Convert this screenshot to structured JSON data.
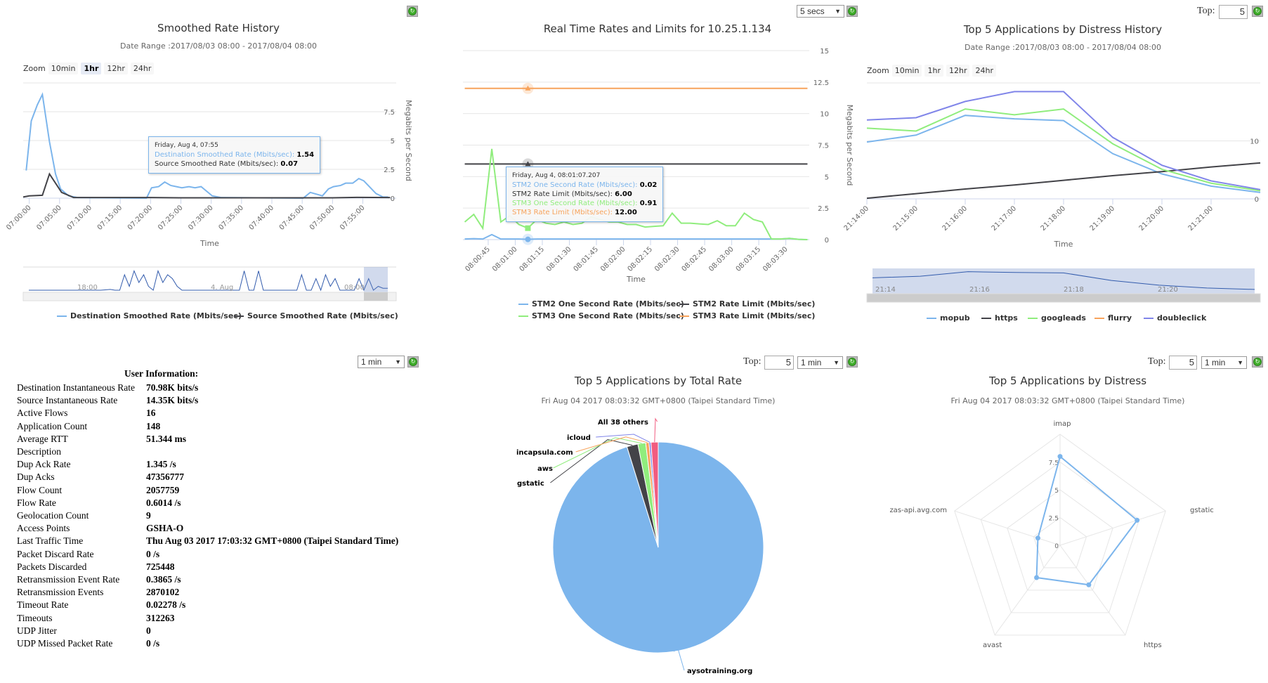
{
  "smoothed": {
    "title": "Smoothed Rate History",
    "date_range": "Date Range :2017/08/03 08:00 - 2017/08/04 08:00",
    "zoom_label": "Zoom",
    "zoom_buttons": [
      "10min",
      "1hr",
      "12hr",
      "24hr"
    ],
    "zoom_selected": "1hr",
    "navigator_labels": [
      "18:00",
      "4. Aug",
      "08:00"
    ],
    "tooltip": {
      "header": "Friday, Aug 4, 07:55",
      "rows": [
        {
          "label": "Destination Smoothed Rate (Mbits/sec): ",
          "value": "1.54",
          "color": "#7cb5ec"
        },
        {
          "label": "Source Smoothed Rate (Mbits/sec): ",
          "value": "0.07",
          "color": "#333333"
        }
      ]
    }
  },
  "realtime": {
    "title": "Real Time Rates and Limits for 10.25.1.134",
    "interval": "5 secs",
    "tooltip": {
      "header": "Friday, Aug 4, 08:01:07.207",
      "rows": [
        {
          "label": "STM2 One Second Rate (Mbits/sec): ",
          "value": "0.02",
          "color": "#7cb5ec"
        },
        {
          "label": "STM2 Rate Limit (Mbits/sec): ",
          "value": "6.00",
          "color": "#333333"
        },
        {
          "label": "STM3 One Second Rate (Mbits/sec): ",
          "value": "0.91",
          "color": "#90ed7d"
        },
        {
          "label": "STM3 Rate Limit (Mbits/sec): ",
          "value": "12.00",
          "color": "#f7a35c"
        }
      ]
    }
  },
  "distress_history": {
    "title": "Top 5 Applications by Distress History",
    "date_range": "Date Range :2017/08/03 08:00 - 2017/08/04 08:00",
    "top_label": "Top:",
    "top_value": "5",
    "zoom_label": "Zoom",
    "zoom_buttons": [
      "10min",
      "1hr",
      "12hr",
      "24hr"
    ],
    "navigator_labels": [
      "21:14",
      "21:16",
      "21:18",
      "21:20"
    ]
  },
  "user_info": {
    "interval": "1 min",
    "header": "User Information:",
    "rows": [
      {
        "label": "Destination Instantaneous Rate",
        "value": "70.98K bits/s"
      },
      {
        "label": "Source Instantaneous Rate",
        "value": "14.35K bits/s"
      },
      {
        "label": "Active Flows",
        "value": "16"
      },
      {
        "label": "Application Count",
        "value": "148"
      },
      {
        "label": "Average RTT",
        "value": "51.344 ms"
      },
      {
        "label": "Description",
        "value": ""
      },
      {
        "label": "Dup Ack Rate",
        "value": "1.345 /s"
      },
      {
        "label": "Dup Acks",
        "value": "47356777"
      },
      {
        "label": "Flow Count",
        "value": "2057759"
      },
      {
        "label": "Flow Rate",
        "value": "0.6014 /s"
      },
      {
        "label": "Geolocation Count",
        "value": "9"
      },
      {
        "label": "Access Points",
        "value": "GSHA-O"
      },
      {
        "label": "Last Traffic Time",
        "value": "Thu Aug 03 2017 17:03:32 GMT+0800 (Taipei Standard Time)"
      },
      {
        "label": "Packet Discard Rate",
        "value": "0 /s"
      },
      {
        "label": "Packets Discarded",
        "value": "725448"
      },
      {
        "label": "Retransmission Event Rate",
        "value": "0.3865 /s"
      },
      {
        "label": "Retransmission Events",
        "value": "2870102"
      },
      {
        "label": "Timeout Rate",
        "value": "0.02278 /s"
      },
      {
        "label": "Timeouts",
        "value": "312263"
      },
      {
        "label": "UDP Jitter",
        "value": "0"
      },
      {
        "label": "UDP Missed Packet Rate",
        "value": "0 /s"
      }
    ]
  },
  "total_rate": {
    "title": "Top 5 Applications by Total Rate",
    "subtitle": "Fri Aug 04 2017 08:03:32 GMT+0800 (Taipei Standard Time)",
    "top_label": "Top:",
    "top_value": "5",
    "interval": "1 min"
  },
  "distress": {
    "title": "Top 5 Applications by Distress",
    "subtitle": "Fri Aug 04 2017 08:03:32 GMT+0800 (Taipei Standard Time)",
    "top_label": "Top:",
    "top_value": "5",
    "interval": "1 min"
  },
  "chart_data": [
    {
      "type": "line",
      "title": "Smoothed Rate History",
      "xlabel": "Time",
      "ylabel": "Megabits per Second",
      "ylim": [
        0,
        10
      ],
      "yticks": [
        "0",
        "2.5",
        "5",
        "7.5"
      ],
      "grid": true,
      "legend": "bottom",
      "xticks": [
        "07:00:00",
        "07:05:00",
        "07:10:00",
        "07:15:00",
        "07:20:00",
        "07:25:00",
        "07:30:00",
        "07:35:00",
        "07:40:00",
        "07:45:00",
        "07:50:00",
        "07:55:00"
      ],
      "series": [
        {
          "name": "Destination Smoothed Rate (Mbits/sec)",
          "color": "#7cb5ec",
          "points": [
            [
              "06:59:30",
              2.4
            ],
            [
              "07:00:20",
              6.7
            ],
            [
              "07:01:20",
              8.1
            ],
            [
              "07:02:10",
              9.0
            ],
            [
              "07:03:20",
              4.9
            ],
            [
              "07:04:20",
              2.1
            ],
            [
              "07:05:10",
              0.8
            ],
            [
              "07:06:30",
              0.2
            ],
            [
              "07:08:00",
              0.05
            ],
            [
              "07:19:20",
              0.0
            ],
            [
              "07:20:10",
              0.9
            ],
            [
              "07:21:20",
              1.0
            ],
            [
              "07:22:20",
              1.4
            ],
            [
              "07:23:20",
              1.1
            ],
            [
              "07:25:10",
              0.9
            ],
            [
              "07:26:20",
              1.0
            ],
            [
              "07:27:20",
              0.9
            ],
            [
              "07:28:20",
              1.0
            ],
            [
              "07:30:10",
              0.2
            ],
            [
              "07:31:40",
              0.05
            ],
            [
              "07:45:10",
              0.0
            ],
            [
              "07:46:20",
              0.5
            ],
            [
              "07:48:20",
              0.2
            ],
            [
              "07:49:20",
              0.8
            ],
            [
              "07:50:10",
              1.0
            ],
            [
              "07:51:20",
              1.1
            ],
            [
              "07:52:10",
              1.3
            ],
            [
              "07:53:20",
              1.3
            ],
            [
              "07:54:20",
              1.7
            ],
            [
              "07:55:10",
              1.5
            ],
            [
              "07:57:10",
              0.4
            ],
            [
              "07:58:20",
              0.1
            ],
            [
              "07:59:10",
              0.1
            ]
          ]
        },
        {
          "name": "Source Smoothed Rate (Mbits/sec)",
          "color": "#434348",
          "points": [
            [
              "06:59:00",
              0.1
            ],
            [
              "07:00:00",
              0.2
            ],
            [
              "07:02:10",
              0.25
            ],
            [
              "07:03:20",
              2.1
            ],
            [
              "07:05:20",
              0.5
            ],
            [
              "07:07:20",
              0.05
            ],
            [
              "07:20:00",
              0.05
            ],
            [
              "07:25:00",
              0.03
            ],
            [
              "07:50:00",
              0.03
            ],
            [
              "07:54:00",
              0.07
            ],
            [
              "07:59:30",
              0.05
            ]
          ]
        }
      ],
      "navigator_series": [
        0,
        0,
        0,
        0,
        0,
        0,
        0,
        0,
        0,
        0,
        0,
        0,
        0,
        0,
        0,
        0,
        0.1,
        0.2,
        0,
        0,
        4,
        1,
        5,
        2,
        4,
        1,
        0,
        5,
        2,
        4,
        3,
        1,
        0,
        0,
        0,
        0,
        0,
        0,
        0,
        0,
        0,
        0,
        0,
        0,
        0,
        5,
        0,
        0,
        5,
        0,
        0,
        0,
        0,
        0,
        0,
        0,
        0,
        4,
        0,
        0,
        3,
        0,
        4,
        1,
        3,
        0,
        0,
        0,
        0,
        3,
        0,
        3,
        0,
        1,
        0.5,
        0.5
      ]
    },
    {
      "type": "line",
      "title": "Real Time Rates and Limits for 10.25.1.134",
      "xlabel": "Time",
      "ylabel": "Megabits per Second",
      "ylim": [
        0,
        15
      ],
      "yticks": [
        "0",
        "2.5",
        "5",
        "7.5",
        "10",
        "12.5",
        "15"
      ],
      "grid": true,
      "legend": "bottom",
      "xticks": [
        "08:00:45",
        "08:01:00",
        "08:01:15",
        "08:01:30",
        "08:01:45",
        "08:02:00",
        "08:02:15",
        "08:02:30",
        "08:02:45",
        "08:03:00",
        "08:03:15",
        "08:03:30"
      ],
      "x": [
        "08:00:32",
        "08:00:37",
        "08:00:42",
        "08:00:47",
        "08:00:52",
        "08:00:57",
        "08:01:02",
        "08:01:07",
        "08:01:12",
        "08:01:17",
        "08:01:22",
        "08:01:27",
        "08:01:32",
        "08:01:37",
        "08:01:42",
        "08:01:47",
        "08:01:52",
        "08:01:57",
        "08:02:02",
        "08:02:07",
        "08:02:12",
        "08:02:17",
        "08:02:22",
        "08:02:27",
        "08:02:32",
        "08:02:37",
        "08:02:42",
        "08:02:47",
        "08:02:52",
        "08:02:57",
        "08:03:02",
        "08:03:07",
        "08:03:12",
        "08:03:17",
        "08:03:22",
        "08:03:27",
        "08:03:32",
        "08:03:37",
        "08:03:42"
      ],
      "series": [
        {
          "name": "STM2 One Second Rate (Mbits/sec)",
          "color": "#7cb5ec",
          "values": [
            0.05,
            0.08,
            0.05,
            0.4,
            0.05,
            0.05,
            0.05,
            0.02,
            0.05,
            0.05,
            0.05,
            0.05,
            0.05,
            0.05,
            0.05,
            0.05,
            0.05,
            0.05,
            0.05,
            0.05,
            0.05,
            0.05,
            0.05,
            0.05,
            0.05,
            0.05,
            0.05,
            0.05,
            0.05,
            0.05,
            0.05,
            0.05,
            0.05,
            0.05,
            0.05,
            0.05,
            0.1,
            0.02,
            0
          ]
        },
        {
          "name": "STM2 Rate Limit (Mbits/sec)",
          "color": "#434348",
          "values": [
            6,
            6,
            6,
            6,
            6,
            6,
            6,
            6,
            6,
            6,
            6,
            6,
            6,
            6,
            6,
            6,
            6,
            6,
            6,
            6,
            6,
            6,
            6,
            6,
            6,
            6,
            6,
            6,
            6,
            6,
            6,
            6,
            6,
            6,
            6,
            6,
            6,
            6,
            6
          ]
        },
        {
          "name": "STM3 One Second Rate (Mbits/sec)",
          "color": "#90ed7d",
          "values": [
            1.4,
            2.0,
            0.9,
            7.2,
            1.4,
            1.9,
            1.2,
            0.91,
            1.6,
            1.3,
            1.2,
            1.4,
            1.2,
            1.3,
            1.8,
            1.6,
            1.4,
            1.4,
            1.2,
            1.2,
            1.0,
            1.05,
            1.1,
            2.1,
            1.3,
            1.3,
            1.25,
            1.2,
            1.5,
            1.1,
            1.1,
            2.1,
            1.6,
            1.4,
            0.05,
            0.05,
            0.1,
            0.02,
            0
          ]
        },
        {
          "name": "STM3 Rate Limit (Mbits/sec)",
          "color": "#f7a35c",
          "values": [
            12,
            12,
            12,
            12,
            12,
            12,
            12,
            12,
            12,
            12,
            12,
            12,
            12,
            12,
            12,
            12,
            12,
            12,
            12,
            12,
            12,
            12,
            12,
            12,
            12,
            12,
            12,
            12,
            12,
            12,
            12,
            12,
            12,
            12,
            12,
            12,
            12,
            12,
            12
          ]
        }
      ]
    },
    {
      "type": "line",
      "title": "Top 5 Applications by Distress History",
      "xlabel": "Time",
      "ylim": [
        0,
        20
      ],
      "yticks": [
        "0",
        "10"
      ],
      "grid": true,
      "legend": "bottom",
      "xticks": [
        "21:14:00",
        "21:15:00",
        "21:16:00",
        "21:17:00",
        "21:18:00",
        "21:19:00",
        "21:20:00",
        "21:21:00"
      ],
      "x": [
        "21:14:00",
        "21:15:00",
        "21:16:00",
        "21:17:00",
        "21:18:00",
        "21:19:00",
        "21:20:00",
        "21:21:00",
        "21:22:00"
      ],
      "series": [
        {
          "name": "mopub",
          "color": "#7cb5ec",
          "values": [
            9.8,
            11.0,
            14.4,
            13.8,
            13.5,
            7.8,
            4.3,
            2.2,
            1.1
          ]
        },
        {
          "name": "https",
          "color": "#434348",
          "values": [
            0.1,
            0.9,
            1.7,
            2.4,
            3.2,
            4.0,
            4.7,
            5.5,
            6.2
          ]
        },
        {
          "name": "googleads",
          "color": "#90ed7d",
          "values": [
            12.2,
            11.7,
            15.5,
            14.5,
            15.5,
            9.5,
            5.1,
            2.7,
            1.4
          ]
        },
        {
          "name": "flurry",
          "color": "#f7a35c",
          "values": []
        },
        {
          "name": "doubleclick",
          "color": "#8085e9",
          "values": [
            13.6,
            14.0,
            16.8,
            18.5,
            18.5,
            10.6,
            5.8,
            3.1,
            1.6
          ]
        }
      ]
    },
    {
      "type": "pie",
      "title": "Top 5 Applications by Total Rate",
      "slices": [
        {
          "name": "aysotraining.org",
          "value": 95.2,
          "color": "#7cb5ec"
        },
        {
          "name": "gstatic",
          "value": 1.7,
          "color": "#434348"
        },
        {
          "name": "aws",
          "value": 1.2,
          "color": "#90ed7d"
        },
        {
          "name": "incapsula.com",
          "value": 0.5,
          "color": "#f7a35c"
        },
        {
          "name": "icloud",
          "value": 0.3,
          "color": "#8085e9"
        },
        {
          "name": "All 38 others",
          "value": 1.1,
          "color": "#f15c80"
        }
      ]
    },
    {
      "type": "radar",
      "title": "Top 5 Applications by Distress",
      "categories": [
        "imap",
        "gstatic",
        "https",
        "avast",
        "zas-api.avg.com"
      ],
      "values": [
        8.0,
        7.3,
        4.4,
        3.6,
        2.1
      ],
      "ylim": [
        0,
        10
      ],
      "yticks": [
        "0",
        "2.5",
        "5",
        "7.5"
      ],
      "color": "#7cb5ec"
    }
  ]
}
